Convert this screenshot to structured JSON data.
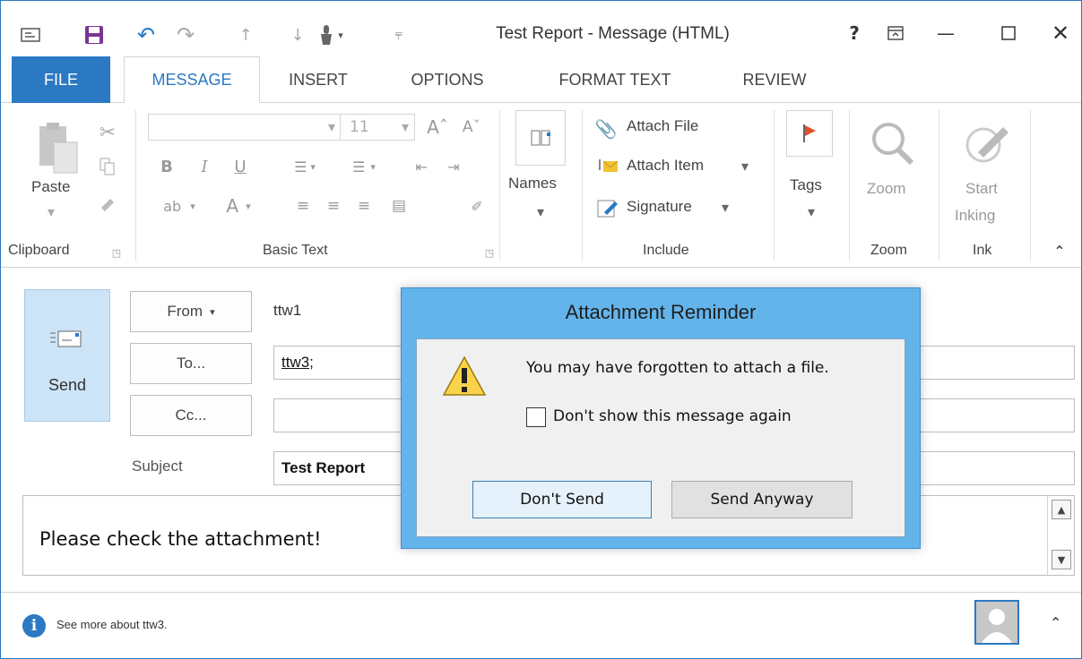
{
  "window": {
    "title": "Test Report - Message (HTML)",
    "help": "?",
    "accent": "#2b79c2"
  },
  "tabs": [
    {
      "label": "FILE"
    },
    {
      "label": "MESSAGE"
    },
    {
      "label": "INSERT"
    },
    {
      "label": "OPTIONS"
    },
    {
      "label": "FORMAT TEXT"
    },
    {
      "label": "REVIEW"
    }
  ],
  "ribbon": {
    "clipboard": {
      "paste_label": "Paste",
      "group_label": "Clipboard"
    },
    "basic_text": {
      "font_size": "11",
      "group_label": "Basic Text"
    },
    "names": {
      "label": "Names"
    },
    "include": {
      "attach_file": "Attach File",
      "attach_item": "Attach Item",
      "signature": "Signature",
      "group_label": "Include"
    },
    "tags": {
      "label": "Tags"
    },
    "zoom": {
      "button_label": "Zoom",
      "group_label": "Zoom"
    },
    "ink": {
      "button_label_1": "Start",
      "button_label_2": "Inking",
      "group_label": "Ink"
    }
  },
  "compose": {
    "send_label": "Send",
    "from_button": "From",
    "from_value": "ttw1",
    "to_button": "To...",
    "to_value": "ttw3;",
    "cc_button": "Cc...",
    "cc_value": "",
    "subject_label": "Subject",
    "subject_value": "Test Report",
    "body_text": "Please check the attachment!"
  },
  "status": {
    "info_text": "See more about ttw3."
  },
  "dialog": {
    "title": "Attachment Reminder",
    "message": "You may have forgotten to attach a file.",
    "checkbox_label": "Don't show this message again",
    "checkbox_checked": false,
    "dont_send_label": "Don't Send",
    "send_anyway_label": "Send Anyway"
  }
}
